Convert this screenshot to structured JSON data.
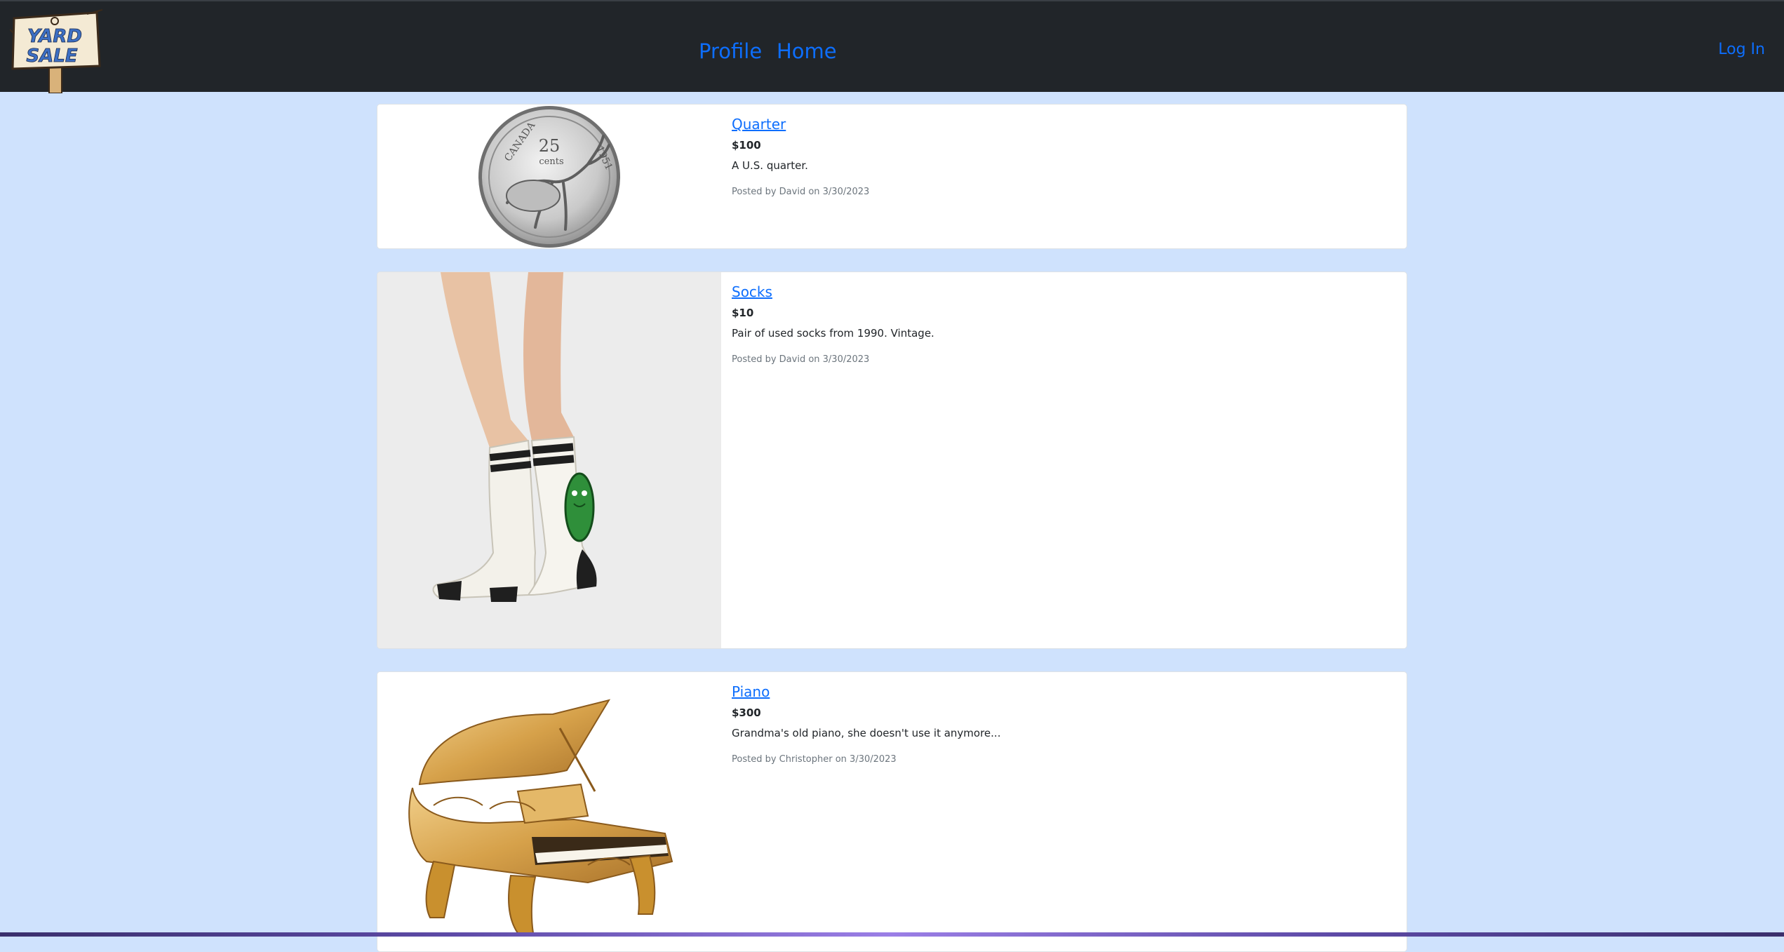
{
  "navbar": {
    "logo_lines": [
      "YARD",
      "SALE"
    ],
    "links": [
      {
        "label": "Profile"
      },
      {
        "label": "Home"
      }
    ],
    "login_label": "Log In"
  },
  "listings": [
    {
      "title": "Quarter",
      "price": "$100",
      "description": "A U.S. quarter.",
      "meta": "Posted by David on 3/30/2023",
      "image_icon": "coin-image",
      "coin_text": {
        "country": "CANADA",
        "value": "25",
        "unit": "cents",
        "year": "1951"
      }
    },
    {
      "title": "Socks",
      "price": "$10",
      "description": "Pair of used socks from 1990. Vintage.",
      "meta": "Posted by David on 3/30/2023",
      "image_icon": "socks-image"
    },
    {
      "title": "Piano",
      "price": "$300",
      "description": "Grandma's old piano, she doesn't use it anymore...",
      "meta": "Posted by Christopher on 3/30/2023",
      "image_icon": "piano-image"
    }
  ],
  "colors": {
    "navbar_bg": "#212529",
    "page_bg": "#cfe2fd",
    "link": "#0d6efd"
  }
}
